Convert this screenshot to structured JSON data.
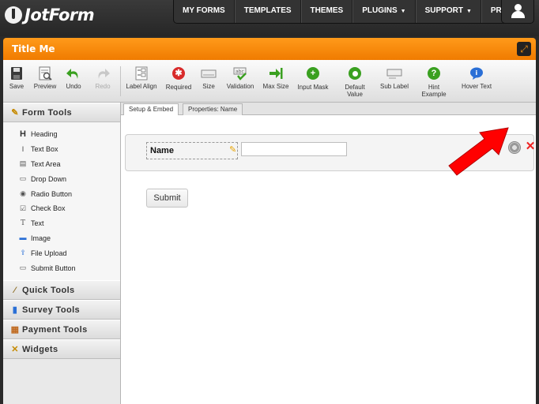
{
  "app": {
    "brand": "JotForm",
    "form_title": "Title Me"
  },
  "nav": {
    "items": [
      {
        "label": "MY FORMS",
        "caret": ""
      },
      {
        "label": "TEMPLATES",
        "caret": ""
      },
      {
        "label": "THEMES",
        "caret": ""
      },
      {
        "label": "PLUGINS",
        "caret": "▼"
      },
      {
        "label": "SUPPORT",
        "caret": "▼"
      },
      {
        "label": "PRICING",
        "caret": ""
      }
    ]
  },
  "toolbar": {
    "save": "Save",
    "preview": "Preview",
    "undo": "Undo",
    "redo": "Redo",
    "label_align": "Label Align",
    "required": "Required",
    "size": "Size",
    "validation": "Validation",
    "max_size": "Max Size",
    "input_mask": "Input Mask",
    "default_value": "Default Value",
    "sub_label": "Sub Label",
    "hint_example": "Hint Example",
    "hover_text": "Hover Text"
  },
  "sidebar": {
    "form_tools": "Form Tools",
    "tools": [
      "Heading",
      "Text Box",
      "Text Area",
      "Drop Down",
      "Radio Button",
      "Check Box",
      "Text",
      "Image",
      "File Upload",
      "Submit Button"
    ],
    "quick_tools": "Quick Tools",
    "survey_tools": "Survey Tools",
    "payment_tools": "Payment Tools",
    "widgets": "Widgets"
  },
  "tabs": {
    "setup": "Setup & Embed",
    "properties": "Properties: Name"
  },
  "form": {
    "name_label": "Name",
    "name_value": "",
    "submit_label": "Submit"
  },
  "colors": {
    "accent": "#f08a00",
    "arrow": "#ff0000",
    "topbar": "#2a2a2a"
  }
}
